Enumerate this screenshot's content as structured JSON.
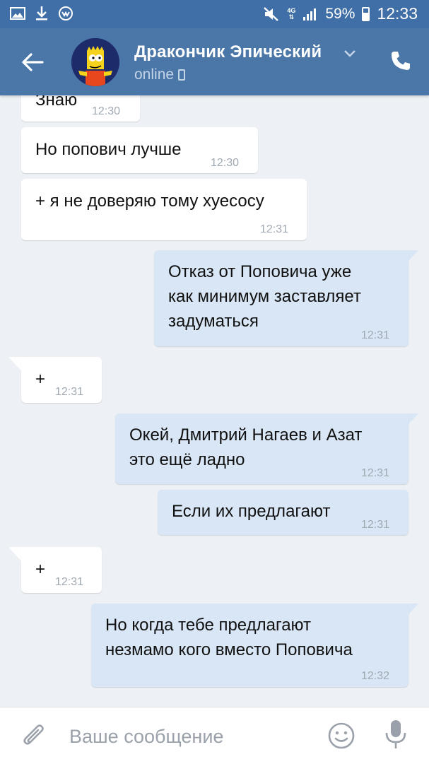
{
  "status_bar": {
    "net": "4G",
    "battery": "59%",
    "time": "12:33"
  },
  "header": {
    "contact_name": "Дракончик Эпический",
    "status": "online"
  },
  "messages": [
    {
      "dir": "in",
      "text": "Знаю",
      "time": "12:30"
    },
    {
      "dir": "in",
      "text": "Но попович лучше",
      "time": "12:30"
    },
    {
      "dir": "in",
      "text": "+ я не доверяю тому хуесосу",
      "time": "12:31"
    },
    {
      "dir": "out",
      "lines": [
        "Отказ от Поповича уже",
        "как минимум заставляет",
        "задуматься"
      ],
      "time": "12:31"
    },
    {
      "dir": "in",
      "text": "+",
      "time": "12:31"
    },
    {
      "dir": "out",
      "lines": [
        "Окей, Дмитрий Нагаев и Азат",
        "это ещё ладно"
      ],
      "time": "12:31"
    },
    {
      "dir": "out",
      "text": "Если их предлагают",
      "time": "12:31"
    },
    {
      "dir": "in",
      "text": "+",
      "time": "12:31"
    },
    {
      "dir": "out",
      "lines": [
        "Но когда тебе предлагают",
        "незмамо кого вместо Поповича"
      ],
      "time": "12:32"
    }
  ],
  "composer": {
    "placeholder": "Ваше сообщение"
  },
  "icons": {
    "back": "arrow-left-icon",
    "phone": "phone-icon",
    "attach": "paperclip-icon",
    "emoji": "smiley-icon",
    "mic": "microphone-icon"
  },
  "colors": {
    "header": "#4a76a8",
    "statusbar": "#3f6fa6",
    "background": "#edf0f4",
    "outgoing_bubble": "#d8e6f5",
    "incoming_bubble": "#ffffff"
  }
}
